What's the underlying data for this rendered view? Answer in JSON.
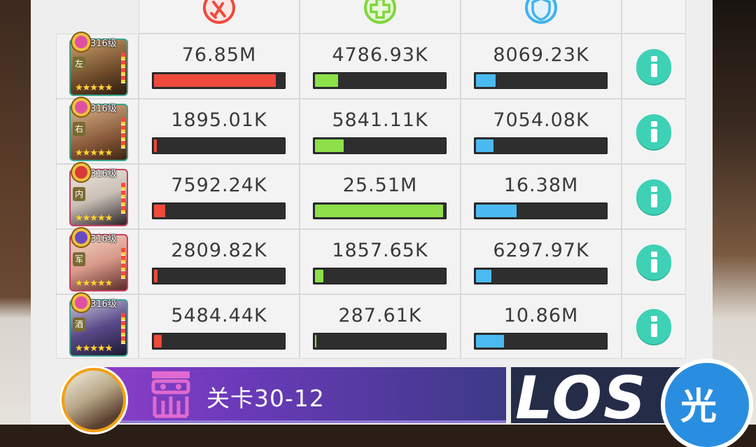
{
  "header": {
    "columns": [
      {
        "icon": "damage-icon",
        "color": "#ef4a3c"
      },
      {
        "icon": "heal-icon",
        "color": "#7fd63c"
      },
      {
        "icon": "shield-icon",
        "color": "#3fb2f0"
      }
    ]
  },
  "heroes": [
    {
      "level": "316级",
      "class_char": "左",
      "stars": "★★★★★",
      "damage": "76.85M",
      "healing": "4786.93K",
      "damage_taken": "8069.23K",
      "damage_pct": 97,
      "healing_pct": 17,
      "damage_taken_pct": 15
    },
    {
      "level": "316级",
      "class_char": "右",
      "stars": "★★★★★",
      "damage": "1895.01K",
      "healing": "5841.11K",
      "damage_taken": "7054.08K",
      "damage_pct": 3,
      "healing_pct": 22,
      "damage_taken_pct": 14
    },
    {
      "level": "316级",
      "class_char": "内",
      "stars": "★★★★★",
      "damage": "7592.24K",
      "healing": "25.51M",
      "damage_taken": "16.38M",
      "damage_pct": 10,
      "healing_pct": 97,
      "damage_taken_pct": 32
    },
    {
      "level": "316级",
      "class_char": "军",
      "stars": "★★★★★",
      "damage": "2809.82K",
      "healing": "1857.65K",
      "damage_taken": "6297.97K",
      "damage_pct": 4,
      "healing_pct": 7,
      "damage_taken_pct": 13
    },
    {
      "level": "316级",
      "class_char": "酒",
      "stars": "★★★★★",
      "damage": "5484.44K",
      "healing": "287.61K",
      "damage_taken": "10.86M",
      "damage_pct": 7,
      "healing_pct": 2,
      "damage_taken_pct": 22
    }
  ],
  "footer": {
    "stage_label": "关卡30-12",
    "result_text": "LOS",
    "skip_label": "光"
  }
}
